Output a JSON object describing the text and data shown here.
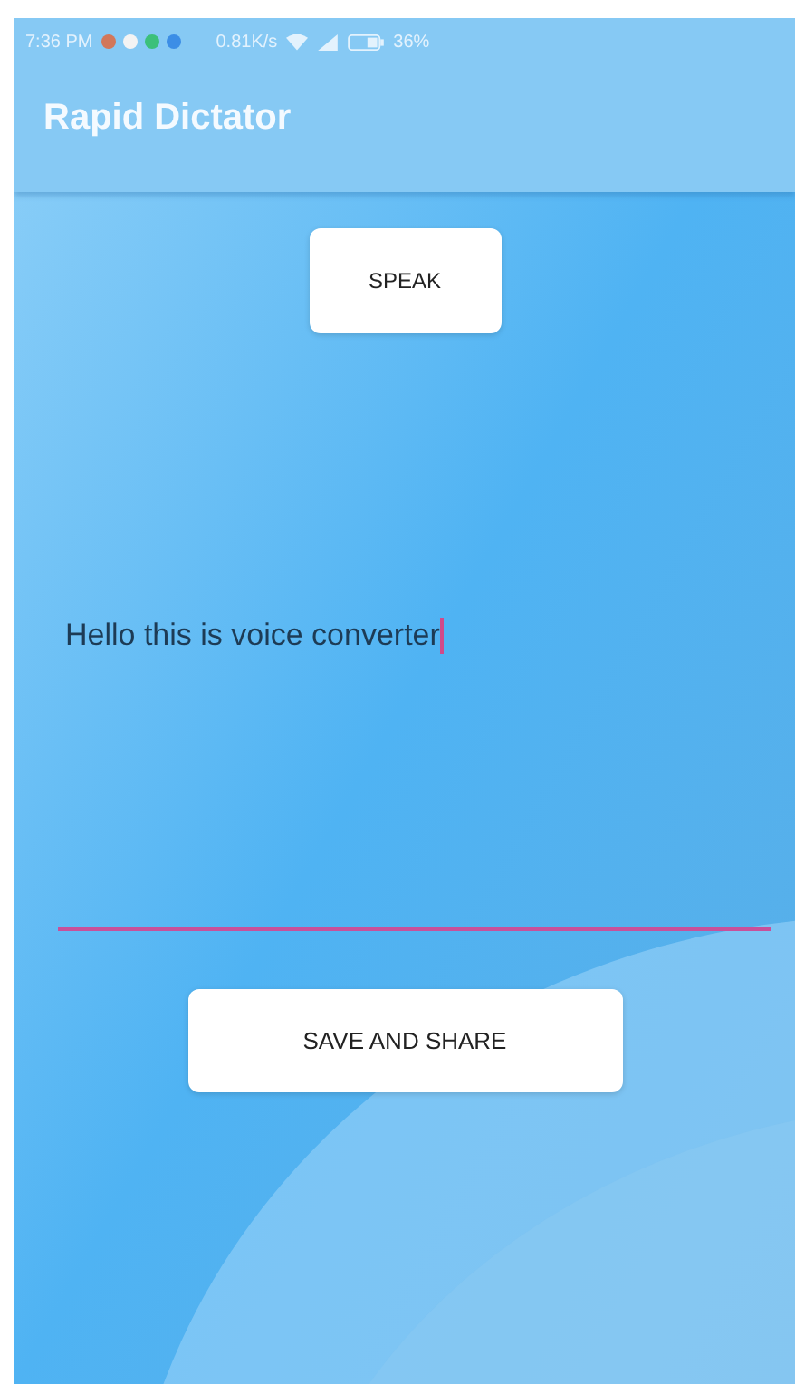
{
  "status_bar": {
    "time": "7:36 PM",
    "network_speed": "0.81K/s",
    "battery": "36%"
  },
  "app_bar": {
    "title": "Rapid Dictator"
  },
  "speak_button": {
    "label": "SPEAK"
  },
  "text_field": {
    "value": "Hello this is voice converter",
    "focused": true
  },
  "save_button": {
    "label": "SAVE AND SHARE"
  }
}
